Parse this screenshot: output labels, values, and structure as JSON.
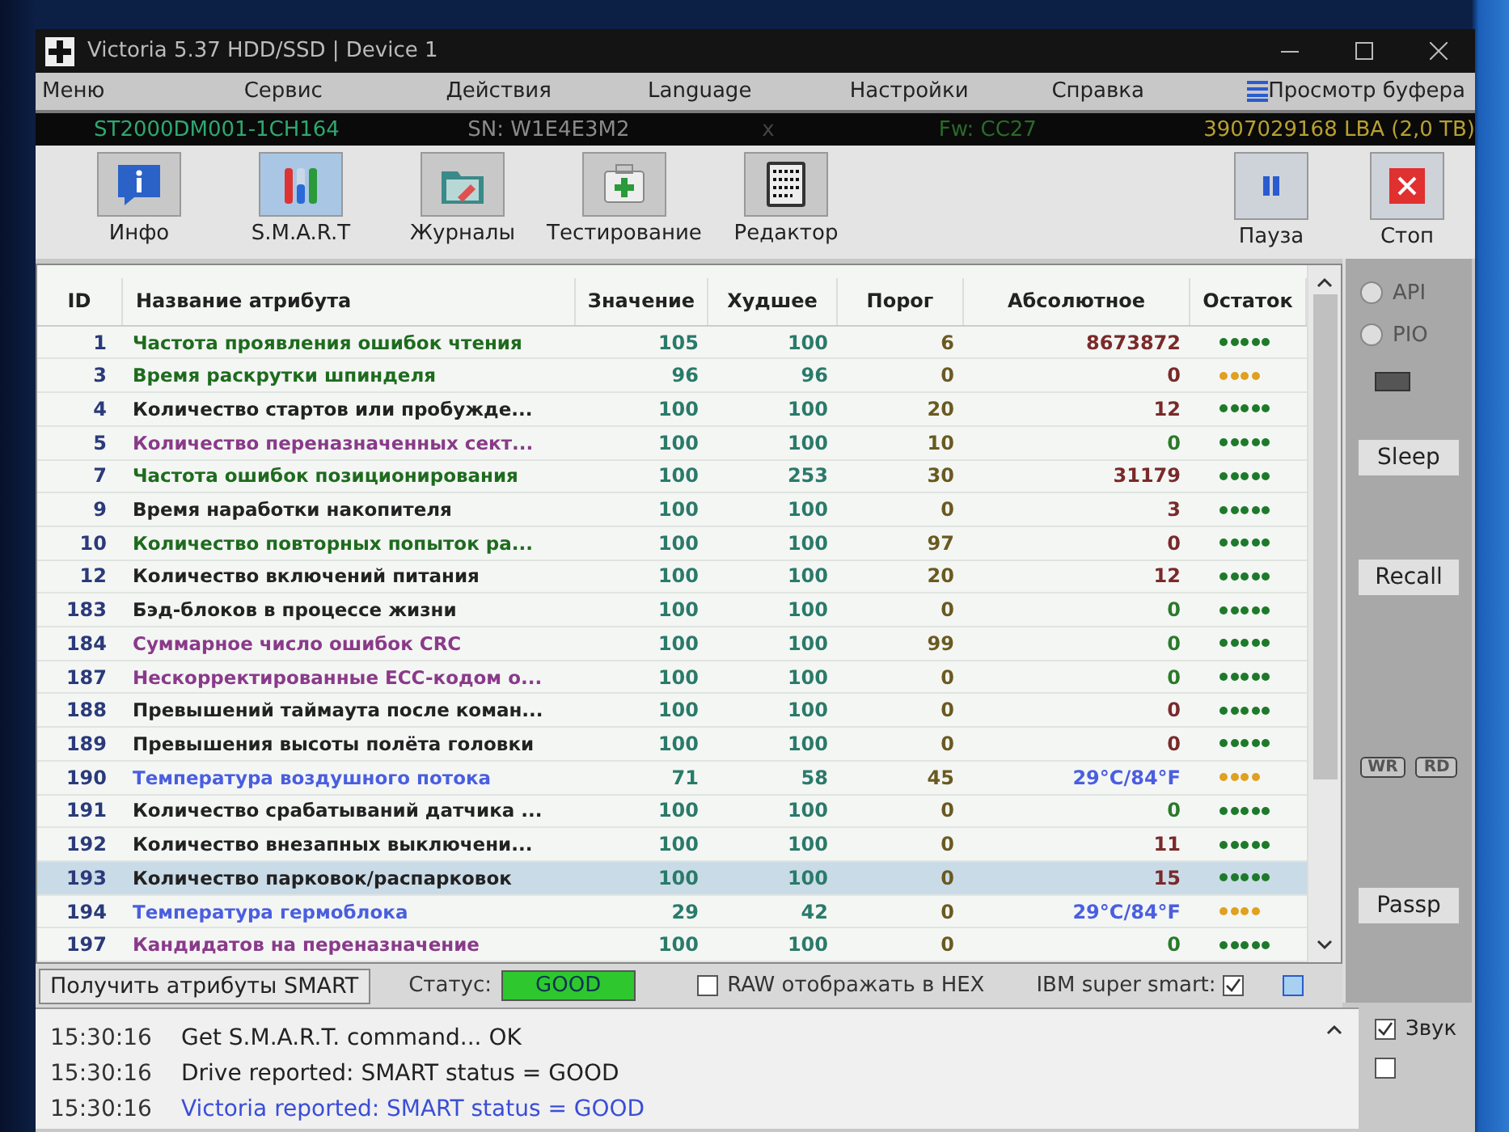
{
  "window": {
    "title": "Victoria 5.37 HDD/SSD | Device 1"
  },
  "menu": [
    {
      "label": "Меню"
    },
    {
      "label": "Сервис"
    },
    {
      "label": "Действия"
    },
    {
      "label": "Language"
    },
    {
      "label": "Настройки"
    },
    {
      "label": "Справка"
    }
  ],
  "buffer_view": "Просмотр буфера",
  "device_bar": {
    "model": "ST2000DM001-1CH164",
    "serial": "SN: W1E4E3M2",
    "separator": "x",
    "firmware": "Fw: CC27",
    "capacity": "3907029168 LBA (2,0 TB)"
  },
  "toolbar": [
    {
      "label": "Инфо",
      "kind": "info",
      "selected": false
    },
    {
      "label": "S.M.A.R.T",
      "kind": "smart",
      "selected": true
    },
    {
      "label": "Журналы",
      "kind": "logs",
      "selected": false
    },
    {
      "label": "Тестирование",
      "kind": "test",
      "selected": false
    },
    {
      "label": "Редактор",
      "kind": "editor",
      "selected": false
    }
  ],
  "toolbar_right": [
    {
      "label": "Пауза",
      "kind": "pause"
    },
    {
      "label": "Стоп",
      "kind": "stop"
    }
  ],
  "table": {
    "columns": [
      "ID",
      "Название атрибута",
      "Значение",
      "Худшее",
      "Порог",
      "Абсолютное",
      "Остаток"
    ],
    "rows": [
      {
        "id": "1",
        "name": "Частота проявления ошибок чтения",
        "color": "#1e6b1e",
        "value": "105",
        "worst": "100",
        "threshold": "6",
        "raw": {
          "text": "8673872",
          "color": "#7a2a2a"
        },
        "stars": 5,
        "selected": false
      },
      {
        "id": "3",
        "name": "Время раскрутки шпинделя",
        "color": "#1e6b1e",
        "value": "96",
        "worst": "96",
        "threshold": "0",
        "raw": {
          "text": "0",
          "color": "#7a2a2a"
        },
        "stars": 4,
        "selected": false
      },
      {
        "id": "4",
        "name": "Количество стартов или пробужде...",
        "color": "#222222",
        "value": "100",
        "worst": "100",
        "threshold": "20",
        "raw": {
          "text": "12",
          "color": "#7a2a2a"
        },
        "stars": 5,
        "selected": false
      },
      {
        "id": "5",
        "name": "Количество переназначенных сект...",
        "color": "#8a3a8a",
        "value": "100",
        "worst": "100",
        "threshold": "10",
        "raw": {
          "text": "0",
          "color": "#2a7a2a"
        },
        "stars": 5,
        "selected": false
      },
      {
        "id": "7",
        "name": "Частота ошибок позиционирования",
        "color": "#1e6b1e",
        "value": "100",
        "worst": "253",
        "threshold": "30",
        "raw": {
          "text": "31179",
          "color": "#7a2a2a"
        },
        "stars": 5,
        "selected": false
      },
      {
        "id": "9",
        "name": "Время наработки накопителя",
        "color": "#222222",
        "value": "100",
        "worst": "100",
        "threshold": "0",
        "raw": {
          "text": "3",
          "color": "#7a2a2a"
        },
        "stars": 5,
        "selected": false
      },
      {
        "id": "10",
        "name": "Количество повторных попыток ра...",
        "color": "#1e6b1e",
        "value": "100",
        "worst": "100",
        "threshold": "97",
        "raw": {
          "text": "0",
          "color": "#7a2a2a"
        },
        "stars": 5,
        "selected": false
      },
      {
        "id": "12",
        "name": "Количество включений питания",
        "color": "#222222",
        "value": "100",
        "worst": "100",
        "threshold": "20",
        "raw": {
          "text": "12",
          "color": "#7a2a2a"
        },
        "stars": 5,
        "selected": false
      },
      {
        "id": "183",
        "name": "Бэд-блоков в процессе жизни",
        "color": "#222222",
        "value": "100",
        "worst": "100",
        "threshold": "0",
        "raw": {
          "text": "0",
          "color": "#2a7a2a"
        },
        "stars": 5,
        "selected": false
      },
      {
        "id": "184",
        "name": "Суммарное число ошибок CRC",
        "color": "#8a3a8a",
        "value": "100",
        "worst": "100",
        "threshold": "99",
        "raw": {
          "text": "0",
          "color": "#2a7a2a"
        },
        "stars": 5,
        "selected": false
      },
      {
        "id": "187",
        "name": "Нескорректированные ECC-кодом о...",
        "color": "#8a3a8a",
        "value": "100",
        "worst": "100",
        "threshold": "0",
        "raw": {
          "text": "0",
          "color": "#2a7a2a"
        },
        "stars": 5,
        "selected": false
      },
      {
        "id": "188",
        "name": "Превышений таймаута после коман...",
        "color": "#222222",
        "value": "100",
        "worst": "100",
        "threshold": "0",
        "raw": {
          "text": "0",
          "color": "#7a2a2a"
        },
        "stars": 5,
        "selected": false
      },
      {
        "id": "189",
        "name": "Превышения высоты полёта головки",
        "color": "#222222",
        "value": "100",
        "worst": "100",
        "threshold": "0",
        "raw": {
          "text": "0",
          "color": "#7a2a2a"
        },
        "stars": 5,
        "selected": false
      },
      {
        "id": "190",
        "name": "Температура воздушного потока",
        "color": "#4a5ee0",
        "value": "71",
        "worst": "58",
        "threshold": "45",
        "raw": {
          "text": "29°C/84°F",
          "color": "#4a5ee0"
        },
        "stars": 4,
        "selected": false
      },
      {
        "id": "191",
        "name": "Количество срабатываний датчика ...",
        "color": "#222222",
        "value": "100",
        "worst": "100",
        "threshold": "0",
        "raw": {
          "text": "0",
          "color": "#2a7a2a"
        },
        "stars": 5,
        "selected": false
      },
      {
        "id": "192",
        "name": "Количество внезапных выключени...",
        "color": "#222222",
        "value": "100",
        "worst": "100",
        "threshold": "0",
        "raw": {
          "text": "11",
          "color": "#7a2a2a"
        },
        "stars": 5,
        "selected": false
      },
      {
        "id": "193",
        "name": "Количество парковок/распарковок",
        "color": "#222222",
        "value": "100",
        "worst": "100",
        "threshold": "0",
        "raw": {
          "text": "15",
          "color": "#7a2a2a"
        },
        "stars": 5,
        "selected": true
      },
      {
        "id": "194",
        "name": "Температура гермоблока",
        "color": "#4a5ee0",
        "value": "29",
        "worst": "42",
        "threshold": "0",
        "raw": {
          "text": "29°C/84°F",
          "color": "#4a5ee0"
        },
        "stars": 4,
        "selected": false
      },
      {
        "id": "197",
        "name": "Кандидатов на переназначение",
        "color": "#8a3a8a",
        "value": "100",
        "worst": "100",
        "threshold": "0",
        "raw": {
          "text": "0",
          "color": "#2a7a2a"
        },
        "stars": 5,
        "selected": false
      }
    ]
  },
  "side_panel": {
    "radios": [
      {
        "label": "API",
        "selected": false
      },
      {
        "label": "PIO",
        "selected": false
      }
    ],
    "buttons": [
      {
        "label": "Sleep"
      },
      {
        "label": "Recall"
      }
    ],
    "indicators": [
      {
        "label": "WR",
        "disabled": true
      },
      {
        "label": "RD",
        "disabled": true
      }
    ],
    "passp": "Passp"
  },
  "status_bar": {
    "get_button": "Получить атрибуты SMART",
    "status_label": "Статус:",
    "status": "GOOD",
    "hex_checkbox": {
      "label": "RAW отображать в HEX",
      "checked": false
    },
    "ibm_label": "IBM super smart:",
    "ibm_checked": true,
    "extra_checked": false
  },
  "log": [
    {
      "time": "15:30:16",
      "text": "Get S.M.A.R.T. command... OK",
      "color": "#222222"
    },
    {
      "time": "15:30:16",
      "text": "Drive reported: SMART status = GOOD",
      "color": "#222222"
    },
    {
      "time": "15:30:16",
      "text": "Victoria reported: SMART status = GOOD",
      "color": "#3a4ed8"
    }
  ],
  "sound": {
    "label": "Звук",
    "checked": true
  },
  "second_option_checked": false
}
